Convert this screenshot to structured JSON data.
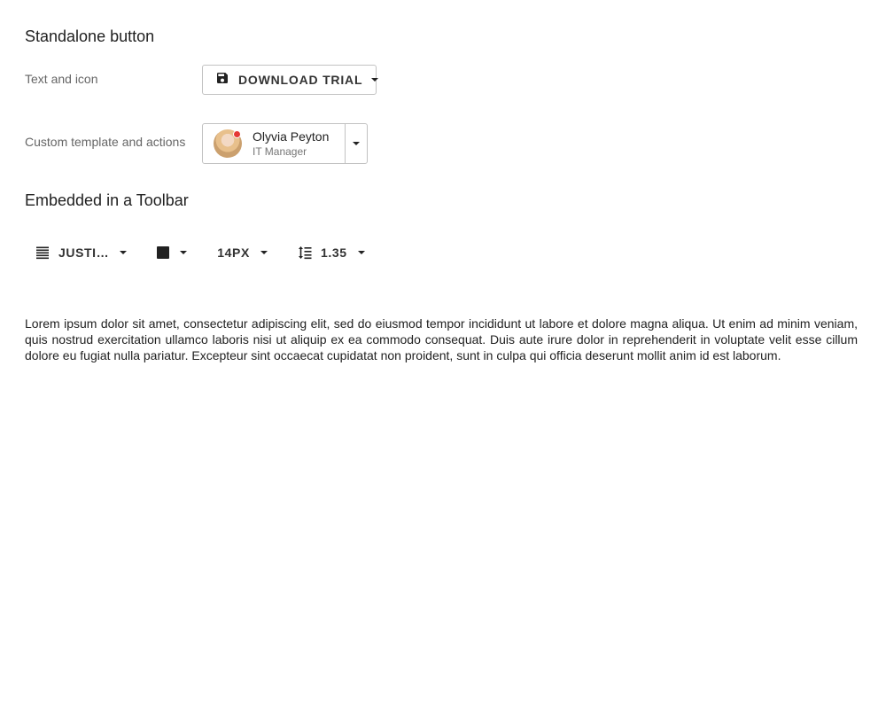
{
  "sections": {
    "standalone_title": "Standalone button",
    "toolbar_title": "Embedded in a Toolbar"
  },
  "rows": {
    "text_icon_label": "Text and icon",
    "custom_label": "Custom template and actions"
  },
  "download_button": {
    "label": "DOWNLOAD TRIAL",
    "icon": "save-icon"
  },
  "user_button": {
    "name": "Olyvia Peyton",
    "role": "IT Manager",
    "status_color": "#e53935"
  },
  "toolbar": {
    "align_label": "JUSTI…",
    "align_icon": "align-justify-icon",
    "color_value": "#212121",
    "size_label": "14PX",
    "line_height_label": "1.35",
    "line_height_icon": "line-height-icon"
  },
  "content": {
    "lorem": "Lorem ipsum dolor sit amet, consectetur adipiscing elit, sed do eiusmod tempor incididunt ut labore et dolore magna aliqua. Ut enim ad minim veniam, quis nostrud exercitation ullamco laboris nisi ut aliquip ex ea commodo consequat. Duis aute irure dolor in reprehenderit in voluptate velit esse cillum dolore eu fugiat nulla pariatur. Excepteur sint occaecat cupidatat non proident, sunt in culpa qui officia deserunt mollit anim id est laborum."
  }
}
